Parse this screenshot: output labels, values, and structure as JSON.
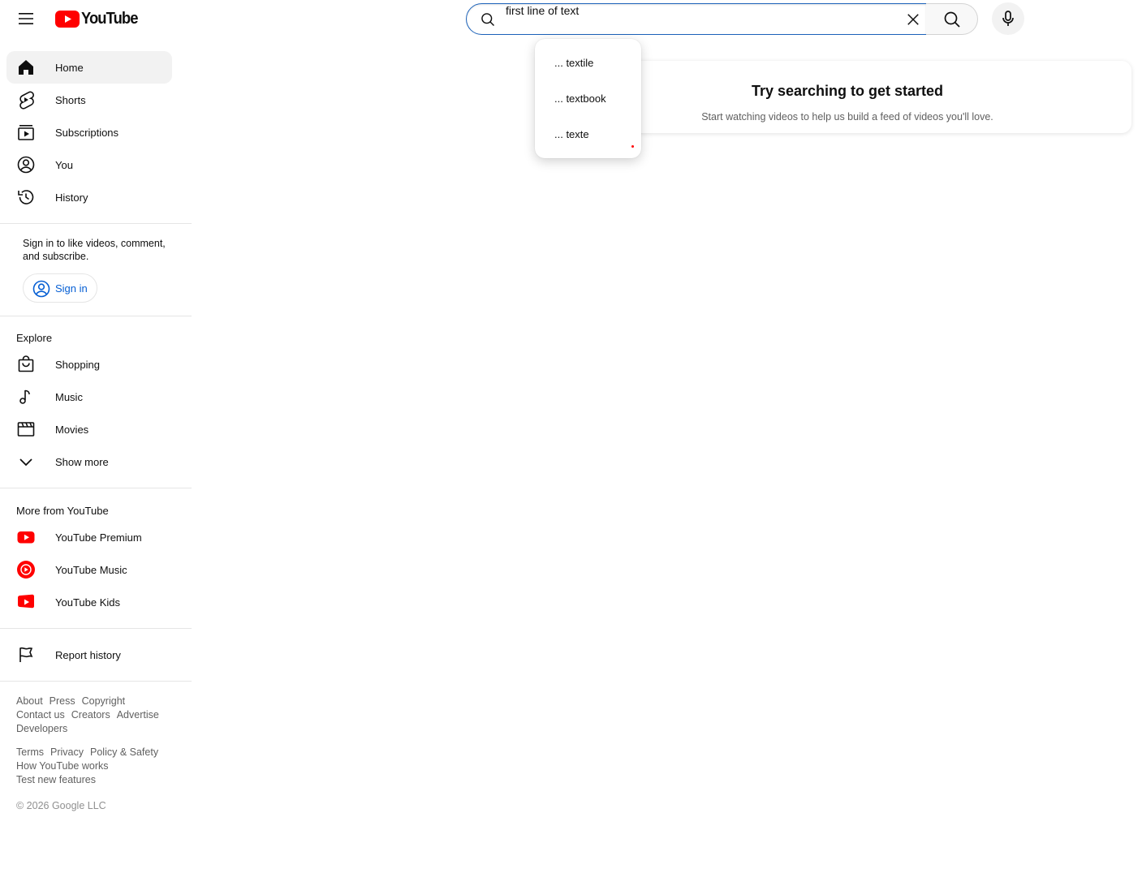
{
  "header": {
    "logo_text": "YouTube",
    "search": {
      "value": "first line of text",
      "placeholder": "Search"
    }
  },
  "suggestions": [
    {
      "label": "... textile"
    },
    {
      "label": "... textbook"
    },
    {
      "label": "... texte"
    }
  ],
  "sidebar": {
    "primary": [
      {
        "label": "Home",
        "icon": "home-icon",
        "active": true
      },
      {
        "label": "Shorts",
        "icon": "shorts-icon"
      },
      {
        "label": "Subscriptions",
        "icon": "subscriptions-icon"
      },
      {
        "label": "You",
        "icon": "account-icon"
      },
      {
        "label": "History",
        "icon": "history-icon"
      }
    ],
    "signin": {
      "prompt": "Sign in to like videos, comment, and subscribe.",
      "button_label": "Sign in"
    },
    "explore": {
      "title": "Explore",
      "items": [
        {
          "label": "Shopping",
          "icon": "shopping-bag-icon"
        },
        {
          "label": "Music",
          "icon": "music-note-icon"
        },
        {
          "label": "Movies",
          "icon": "clapperboard-icon"
        },
        {
          "label": "Show more",
          "icon": "chevron-down-icon"
        }
      ]
    },
    "more": {
      "title": "More from YouTube",
      "items": [
        {
          "label": "YouTube Premium",
          "icon": "youtube-premium-icon"
        },
        {
          "label": "YouTube Music",
          "icon": "youtube-music-icon"
        },
        {
          "label": "YouTube Kids",
          "icon": "youtube-kids-icon"
        }
      ]
    },
    "report": {
      "label": "Report history",
      "icon": "flag-icon"
    },
    "footer": {
      "row1": [
        "About",
        "Press",
        "Copyright",
        "Contact us",
        "Creators",
        "Advertise",
        "Developers"
      ],
      "row2": [
        "Terms",
        "Privacy",
        "Policy & Safety",
        "How YouTube works",
        "Test new features"
      ],
      "copyright": "© 2026 Google LLC"
    }
  },
  "main": {
    "empty_title": "Try searching to get started",
    "empty_subtitle": "Start watching videos to help us build a feed of videos you'll love."
  },
  "colors": {
    "brand_red": "#ff0000",
    "link_blue": "#065fd4",
    "focus_border": "#1c62b9"
  }
}
